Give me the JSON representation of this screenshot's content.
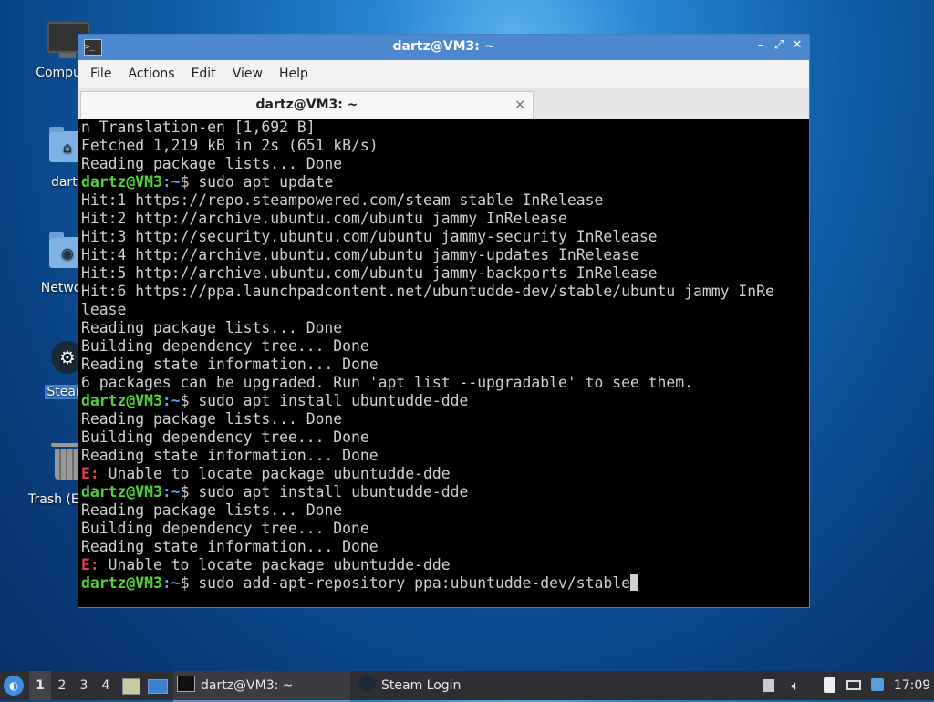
{
  "desktop": {
    "icons": [
      {
        "label": "Computer"
      },
      {
        "label": "dartz"
      },
      {
        "label": "Network"
      },
      {
        "label": "Steam"
      },
      {
        "label": "Trash (Empty)"
      }
    ]
  },
  "window": {
    "title": "dartz@VM3: ~",
    "menu": [
      "File",
      "Actions",
      "Edit",
      "View",
      "Help"
    ],
    "tab": {
      "label": "dartz@VM3: ~",
      "close": "×"
    },
    "controls": {
      "minimize": "–",
      "maximize": "⤢",
      "close": "✕"
    },
    "app_icon": ">_"
  },
  "terminal": {
    "prompt_user": "dartz@VM3",
    "prompt_path": ":~",
    "prompt_sign": "$ ",
    "lines": [
      {
        "t": "out",
        "text": "n Translation-en [1,692 B]"
      },
      {
        "t": "out",
        "text": "Fetched 1,219 kB in 2s (651 kB/s)"
      },
      {
        "t": "out",
        "text": "Reading package lists... Done"
      },
      {
        "t": "cmd",
        "text": "sudo apt update"
      },
      {
        "t": "out",
        "text": "Hit:1 https://repo.steampowered.com/steam stable InRelease"
      },
      {
        "t": "out",
        "text": "Hit:2 http://archive.ubuntu.com/ubuntu jammy InRelease"
      },
      {
        "t": "out",
        "text": "Hit:3 http://security.ubuntu.com/ubuntu jammy-security InRelease"
      },
      {
        "t": "out",
        "text": "Hit:4 http://archive.ubuntu.com/ubuntu jammy-updates InRelease"
      },
      {
        "t": "out",
        "text": "Hit:5 http://archive.ubuntu.com/ubuntu jammy-backports InRelease"
      },
      {
        "t": "out",
        "text": "Hit:6 https://ppa.launchpadcontent.net/ubuntudde-dev/stable/ubuntu jammy InRe"
      },
      {
        "t": "out",
        "text": "lease"
      },
      {
        "t": "out",
        "text": "Reading package lists... Done"
      },
      {
        "t": "out",
        "text": "Building dependency tree... Done"
      },
      {
        "t": "out",
        "text": "Reading state information... Done"
      },
      {
        "t": "out",
        "text": "6 packages can be upgraded. Run 'apt list --upgradable' to see them."
      },
      {
        "t": "cmd",
        "text": "sudo apt install ubuntudde-dde"
      },
      {
        "t": "out",
        "text": "Reading package lists... Done"
      },
      {
        "t": "out",
        "text": "Building dependency tree... Done"
      },
      {
        "t": "out",
        "text": "Reading state information... Done"
      },
      {
        "t": "err",
        "prefix": "E:",
        "text": " Unable to locate package ubuntudde-dde"
      },
      {
        "t": "cmd",
        "text": "sudo apt install ubuntudde-dde"
      },
      {
        "t": "out",
        "text": "Reading package lists... Done"
      },
      {
        "t": "out",
        "text": "Building dependency tree... Done"
      },
      {
        "t": "out",
        "text": "Reading state information... Done"
      },
      {
        "t": "err",
        "prefix": "E:",
        "text": " Unable to locate package ubuntudde-dde"
      },
      {
        "t": "cur",
        "text": "sudo add-apt-repository ppa:ubuntudde-dev/stable"
      }
    ]
  },
  "taskbar": {
    "workspaces": [
      "1",
      "2",
      "3",
      "4"
    ],
    "tasks": [
      {
        "label": "dartz@VM3: ~",
        "icon": "terminal-icon"
      },
      {
        "label": "Steam Login",
        "icon": "steam-icon"
      }
    ],
    "clock": "17:09"
  },
  "colors": {
    "prompt_user": "#52d23a",
    "prompt_path": "#5aa0f0",
    "error": "#e04050",
    "titlebar": "#4d88cf"
  }
}
